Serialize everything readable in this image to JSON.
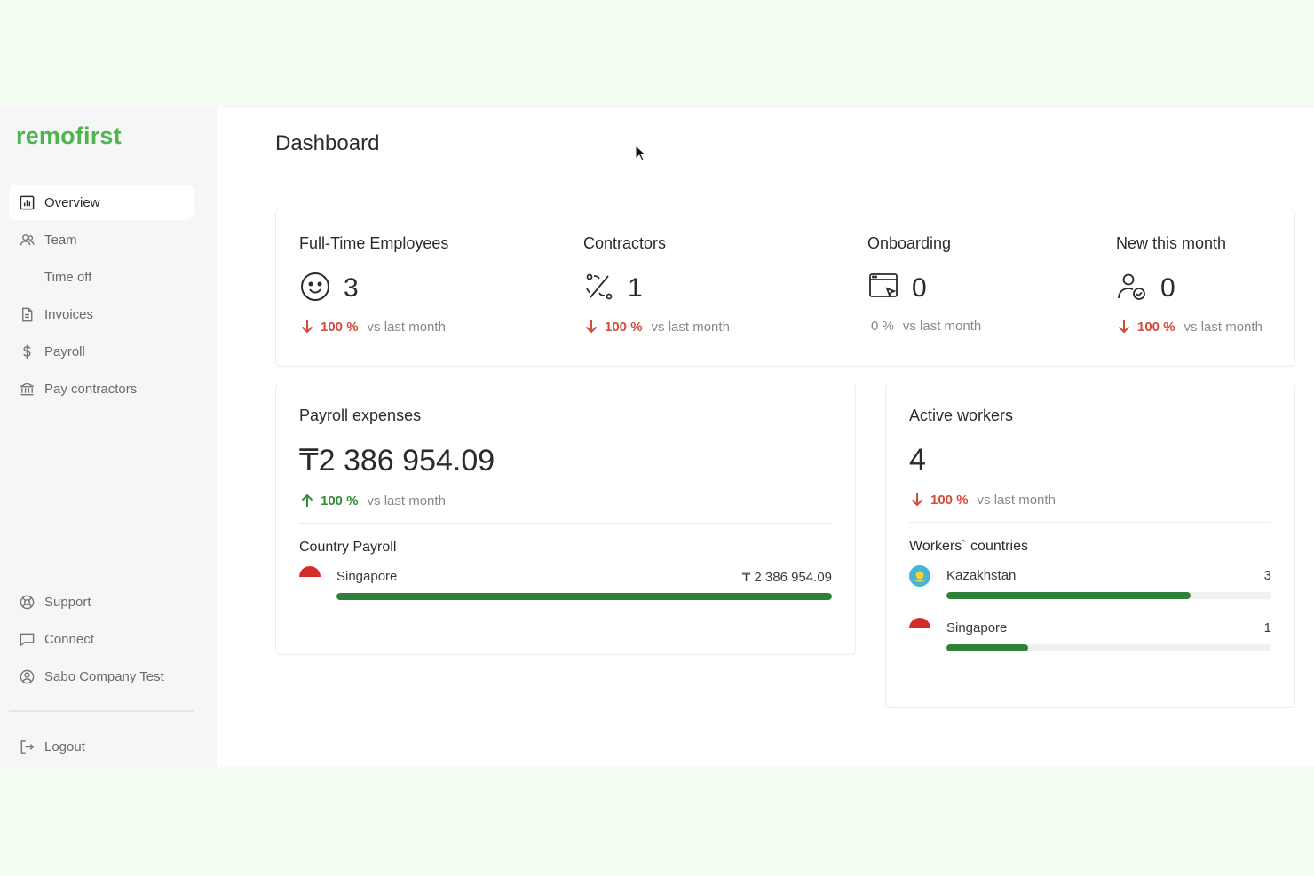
{
  "brand": {
    "name": "remofirst",
    "color": "#4cb54f"
  },
  "sidebar": {
    "items": [
      {
        "label": "Overview",
        "icon": "overview-icon",
        "active": true
      },
      {
        "label": "Team",
        "icon": "team-icon"
      },
      {
        "label": "Time off",
        "icon": ""
      },
      {
        "label": "Invoices",
        "icon": "invoice-icon"
      },
      {
        "label": "Payroll",
        "icon": "dollar-icon"
      },
      {
        "label": "Pay contractors",
        "icon": "bank-icon"
      }
    ],
    "bottom_items": [
      {
        "label": "Support",
        "icon": "support-icon"
      },
      {
        "label": "Connect",
        "icon": "chat-icon"
      },
      {
        "label": "Sabo Company Test",
        "icon": "user-circle-icon"
      }
    ],
    "logout": {
      "label": "Logout",
      "icon": "logout-icon"
    }
  },
  "page": {
    "title": "Dashboard"
  },
  "stats": [
    {
      "title": "Full-Time Employees",
      "icon": "smile-icon",
      "value": "3",
      "pct": "100 %",
      "direction": "down",
      "vs": "vs last month"
    },
    {
      "title": "Contractors",
      "icon": "contract-icon",
      "value": "1",
      "pct": "100 %",
      "direction": "down",
      "vs": "vs last month"
    },
    {
      "title": "Onboarding",
      "icon": "onboarding-icon",
      "value": "0",
      "pct": "0 %",
      "direction": "neutral",
      "vs": "vs last month"
    },
    {
      "title": "New this month",
      "icon": "new-user-icon",
      "value": "0",
      "pct": "100 %",
      "direction": "down",
      "vs": "vs last month"
    }
  ],
  "payroll": {
    "title": "Payroll expenses",
    "value": "₸2 386 954.09",
    "pct": "100 %",
    "direction": "up",
    "vs": "vs last month",
    "subtitle": "Country Payroll",
    "countries": [
      {
        "name": "Singapore",
        "amount": "₸ 2 386 954.09",
        "share": 1.0,
        "flag": "singapore-flag-icon"
      }
    ]
  },
  "workers": {
    "title": "Active workers",
    "value": "4",
    "pct": "100 %",
    "direction": "down",
    "vs": "vs last month",
    "subtitle": "Workers` countries",
    "countries": [
      {
        "name": "Kazakhstan",
        "count": "3",
        "share": 0.75,
        "flag": "kazakhstan-flag-icon"
      },
      {
        "name": "Singapore",
        "count": "1",
        "share": 0.25,
        "flag": "singapore-flag-icon"
      }
    ]
  },
  "colors": {
    "down": "#d64a3a",
    "up": "#2f8f35",
    "bar": "#2f8038",
    "background": "#f3fdf1"
  }
}
